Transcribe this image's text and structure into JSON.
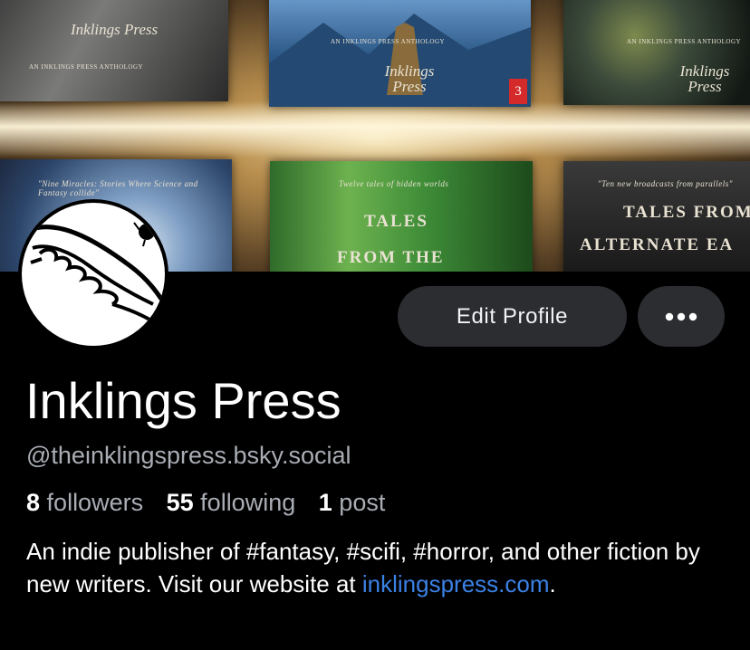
{
  "banner": {
    "tiles": {
      "t1": {
        "brand": "Inklings Press",
        "series": "AN INKLINGS PRESS ANTHOLOGY"
      },
      "t2": {
        "series": "AN INKLINGS PRESS ANTHOLOGY",
        "brand": "Inklings Press",
        "badge": "3"
      },
      "t3": {
        "series": "AN INKLINGS PRESS ANTHOLOGY",
        "brand": "Inklings Press"
      },
      "t4": {
        "blurb": "\"Nine Miracles: Stories Where Science and Fantasy collide\""
      },
      "t5": {
        "blurb": "Twelve tales of hidden worlds",
        "title_line1": "TALES",
        "title_line2": "FROM THE"
      },
      "t6": {
        "blurb": "\"Ten new broadcasts from parallels\"",
        "title_line1": "TALES FROM",
        "title_line2": "ALTERNATE EA"
      }
    }
  },
  "profile": {
    "edit_label": "Edit Profile",
    "more_label": "•••",
    "display_name": "Inklings Press",
    "handle": "@theinklingspress.bsky.social",
    "stats": {
      "followers_count": "8",
      "followers_label": "followers",
      "following_count": "55",
      "following_label": "following",
      "posts_count": "1",
      "posts_label": "post"
    },
    "bio_text": "An indie publisher of #fantasy, #scifi, #horror, and other fiction by new writers. Visit our website at ",
    "bio_link": "inklingspress.com",
    "bio_end": "."
  },
  "colors": {
    "background": "#000000",
    "button_bg": "#2b2d31",
    "muted_text": "#a9adb4",
    "link": "#3b82e6"
  },
  "icons": {
    "more": "ellipsis-horizontal-icon",
    "avatar": "quill-pen-logo"
  }
}
